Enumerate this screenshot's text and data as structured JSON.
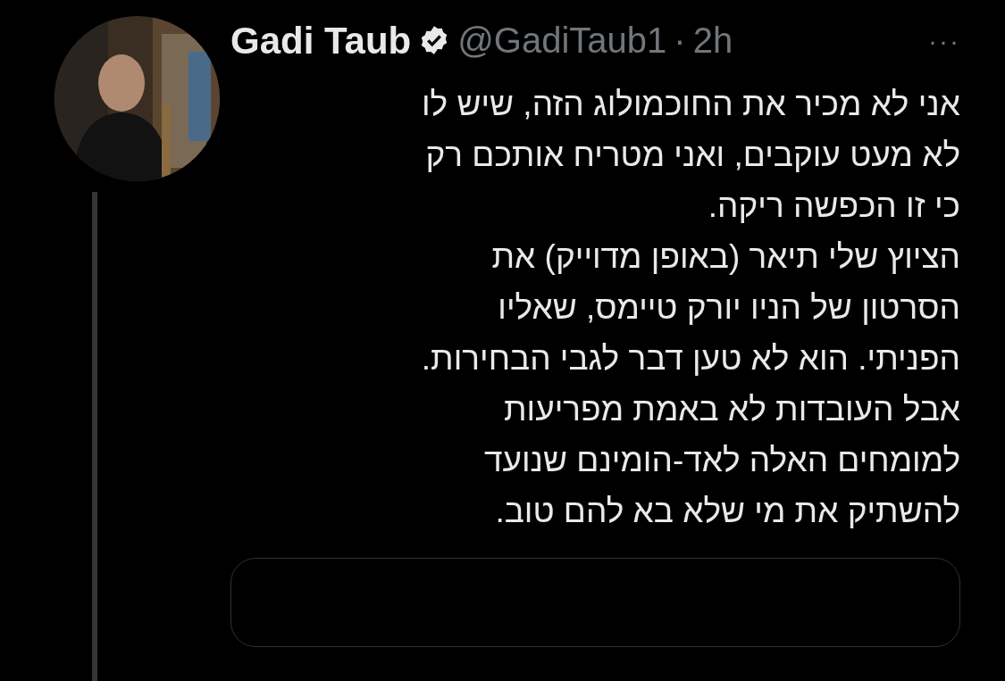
{
  "tweet": {
    "author": "Gadi Taub",
    "verified": true,
    "handle": "@GadiTaub1",
    "separator": "·",
    "time": "2h",
    "more": "···",
    "paragraphs": [
      [
        "אני לא מכיר את החוכמולוג הזה, שיש לו",
        "לא מעט עוקבים, ואני מטריח אותכם רק",
        "כי זו הכפשה ריקה."
      ],
      [
        "הציוץ שלי תיאר (באופן מדוייק) את",
        "הסרטון של הניו יורק טיימס, שאליו",
        "הפניתי. הוא לא טען דבר לגבי הבחירות.",
        "אבל העובדות לא באמת מפריעות",
        "למומחים האלה לאד-הומינם שנועד",
        "להשתיק את מי שלא בא להם טוב."
      ]
    ],
    "quoted": {
      "kind": "card"
    }
  }
}
